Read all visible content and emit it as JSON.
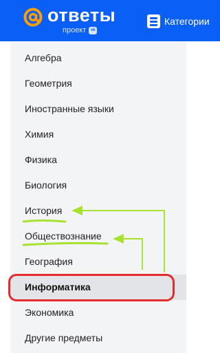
{
  "header": {
    "logo_text": "ответы",
    "logo_subtitle": "проект",
    "vk_badge": "vk",
    "categories_label": "Категории",
    "background_color": "#0a5ff6",
    "logo_accent_color": "#ff9e00"
  },
  "sidebar": {
    "items": [
      {
        "label": "Алгебра"
      },
      {
        "label": "Геометрия"
      },
      {
        "label": "Иностранные языки"
      },
      {
        "label": "Химия"
      },
      {
        "label": "Физика"
      },
      {
        "label": "Биология"
      },
      {
        "label": "История"
      },
      {
        "label": "Обществознание"
      },
      {
        "label": "География"
      },
      {
        "label": "Информатика",
        "active": true
      },
      {
        "label": "Экономика"
      },
      {
        "label": "Другие предметы"
      }
    ]
  },
  "annotations": {
    "underline_color": "#a6e22e",
    "highlight_color": "#e52b2b",
    "underlined_items": [
      "История",
      "Обществознание"
    ],
    "circled_item": "Информатика"
  }
}
